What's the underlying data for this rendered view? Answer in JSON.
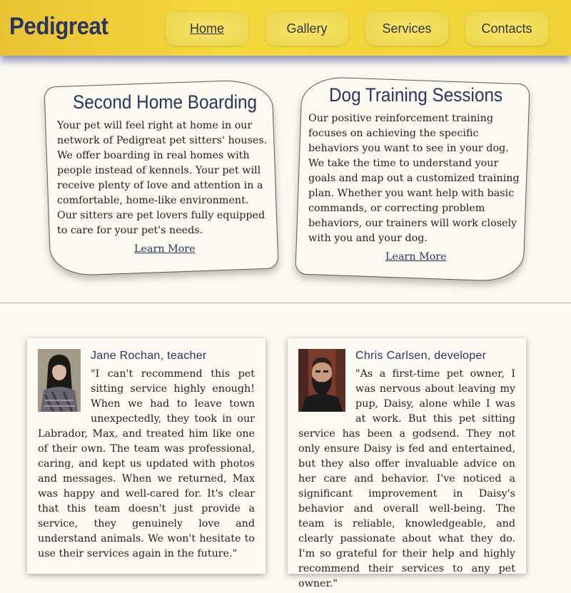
{
  "header": {
    "logo": "Pedigreat",
    "nav": [
      {
        "label": "Home",
        "active": true
      },
      {
        "label": "Gallery",
        "active": false
      },
      {
        "label": "Services",
        "active": false
      },
      {
        "label": "Contacts",
        "active": false
      }
    ],
    "colors": {
      "header": "#efd238",
      "brand": "#2b3360"
    }
  },
  "services": [
    {
      "title": "Second Home Boarding",
      "lines": [
        "Your pet will feel right at home in our",
        "network of Pedigreat pet sitters' houses.",
        "We offer boarding in real homes with",
        "people instead of kennels. Your pet will",
        "receive plenty of love and attention in a",
        "comfortable, home-like environment.",
        "Our sitters are pet lovers fully equipped",
        "to care for your pet's needs."
      ],
      "link": "Learn More"
    },
    {
      "title": "Dog Training Sessions",
      "lines": [
        "Our positive reinforcement training",
        "focuses on achieving the specific",
        "behaviors you want to see in your dog.",
        "We take the time to understand your",
        "goals and map out a customized training",
        "plan. Whether you want help with basic",
        "commands, or correcting problem",
        "behaviors, our trainers will work closely",
        "with you and your dog."
      ],
      "link": "Learn More"
    }
  ],
  "testimonials": [
    {
      "name": "Jane Rochan, teacher",
      "text": "\"I can't recommend this pet sitting service highly enough! When we had to leave town unexpectedly, they took in our Labrador, Max, and treated him like one of their own. The team was professional, caring, and kept us updated with photos and messages. When we returned, Max was happy and well-cared for. It's clear that this team doesn't just provide a service, they genuinely love and understand animals. We won't hesitate to use their services again in the future.\""
    },
    {
      "name": "Chris Carlsen, developer",
      "text": "\"As a first-time pet owner, I was nervous about leaving my pup, Daisy, alone while I was at work. But this pet sitting service has been a godsend. They not only ensure Daisy is fed and entertained, but they also offer invaluable advice on her care and behavior. I've noticed a significant improvement in Daisy's behavior and overall well-being. The team is reliable, knowledgeable, and clearly passionate about what they do. I'm so grateful for their help and highly recommend their services to any pet owner.\""
    }
  ]
}
